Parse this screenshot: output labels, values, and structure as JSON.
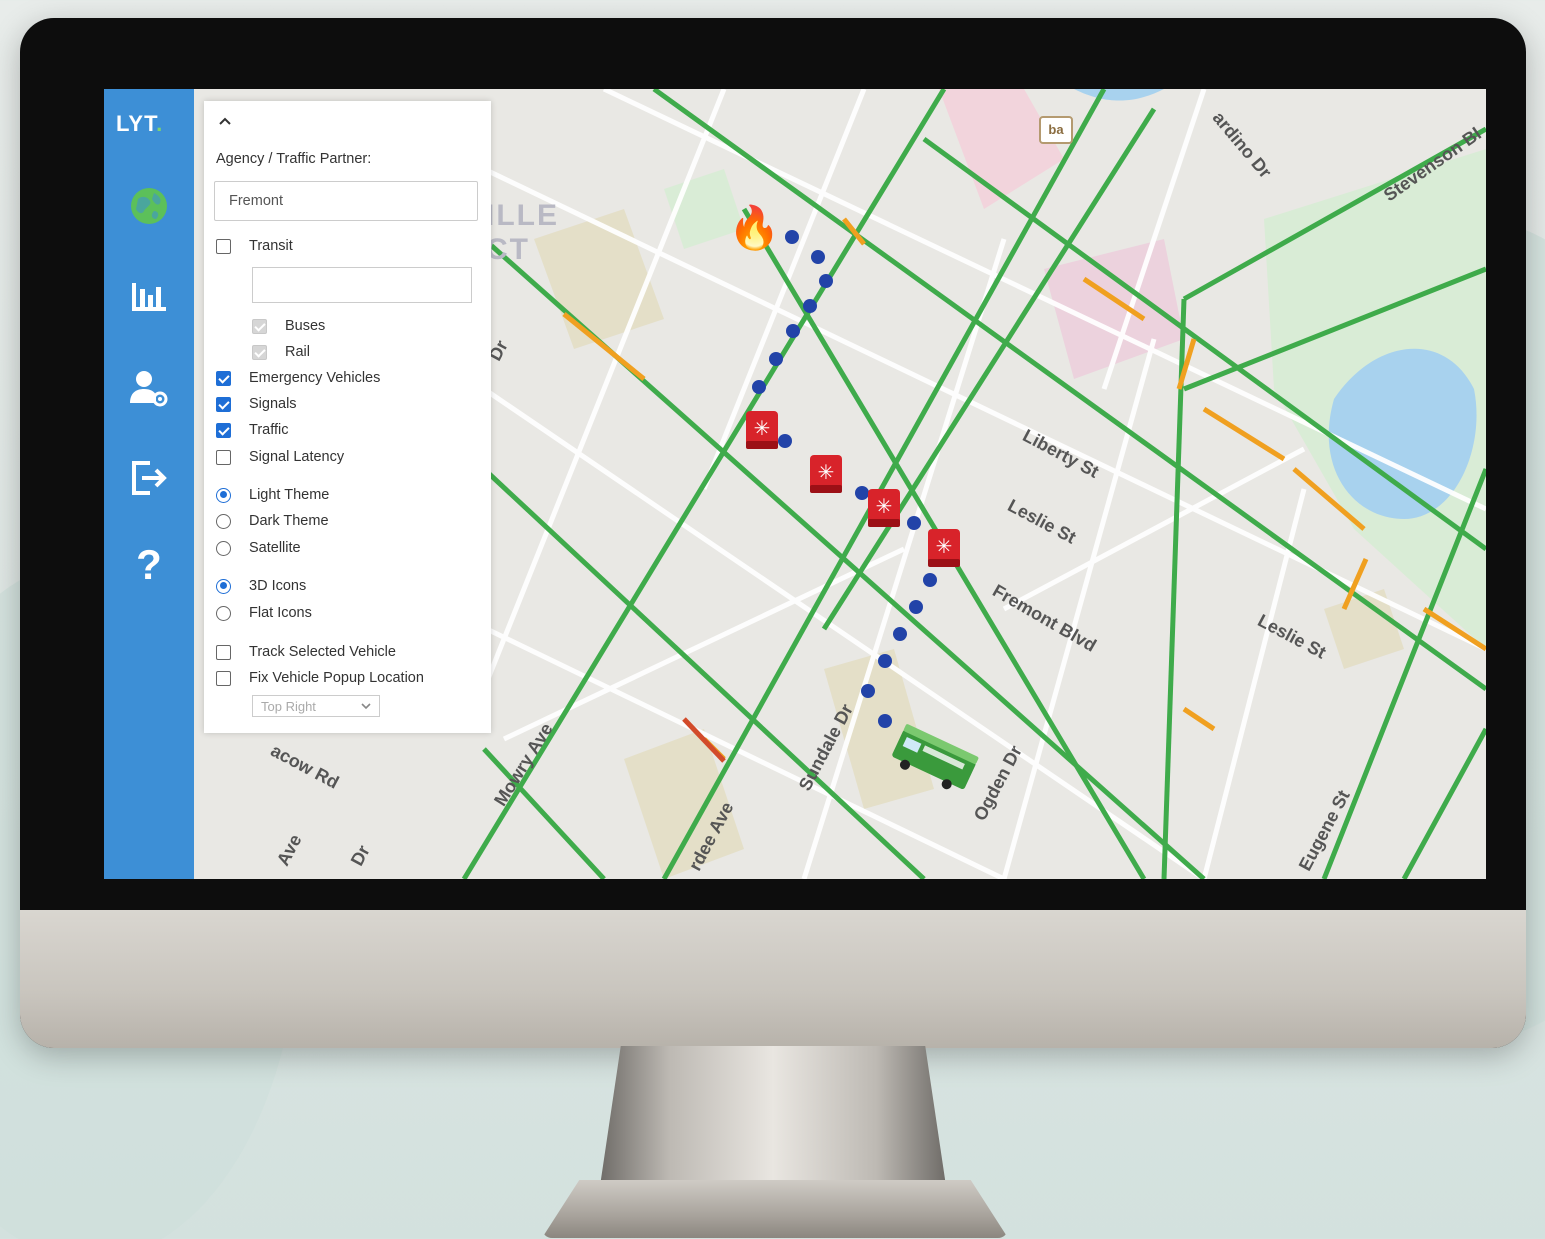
{
  "app": {
    "logo": "LYT",
    "logo_accent": ".",
    "accent_color": "#3d8fd6"
  },
  "sidebar": {
    "items": [
      {
        "icon": "globe-icon"
      },
      {
        "icon": "bar-chart-icon"
      },
      {
        "icon": "user-settings-icon"
      },
      {
        "icon": "logout-icon"
      },
      {
        "icon": "help-icon",
        "glyph": "?"
      }
    ]
  },
  "panel": {
    "collapse_glyph": "^",
    "agency_label": "Agency / Traffic Partner:",
    "agency_value": "Fremont",
    "transit": "Transit",
    "buses": "Buses",
    "rail": "Rail",
    "emergency_vehicles": "Emergency Vehicles",
    "signals": "Signals",
    "traffic": "Traffic",
    "signal_latency": "Signal Latency",
    "light_theme": "Light Theme",
    "dark_theme": "Dark Theme",
    "satellite": "Satellite",
    "icons_3d": "3D Icons",
    "flat_icons": "Flat Icons",
    "track_selected_vehicle": "Track Selected Vehicle",
    "fix_vehicle_popup_location": "Fix Vehicle Popup Location",
    "popup_location_value": "Top Right"
  },
  "map": {
    "streets": {
      "liberty": "Liberty St",
      "leslie1": "Leslie St",
      "leslie2": "Leslie St",
      "fremont": "Fremont Blvd",
      "sundale": "Sundale Dr",
      "ogden": "Ogden Dr",
      "mowry": "Mowry Ave",
      "eugene": "Eugene St",
      "stevenson": "Stevenson Bl",
      "bardino": "ardino Dr",
      "peacow": "acow Rd",
      "dee": "rdee Ave",
      "ave": "Ave",
      "dr_left": "Dr",
      "dr_top": "Dr",
      "faint1": "ILLE",
      "faint2": "CT"
    },
    "bart_label": "ba",
    "fire_icon": "🔥",
    "road_color": "#3fab4b",
    "congestion_color": "#f0a020",
    "route_color": "#2243a8"
  }
}
